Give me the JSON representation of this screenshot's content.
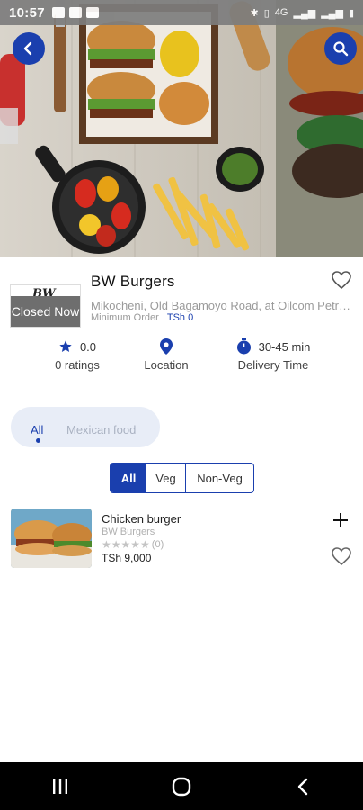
{
  "status_bar": {
    "time": "10:57",
    "network": "4G"
  },
  "hero": {
    "back_icon": "arrow-left-icon",
    "search_icon": "search-icon"
  },
  "restaurant": {
    "logo_text": "BW",
    "status": "Closed Now",
    "name": "BW Burgers",
    "address": "Mikocheni, Old Bagamoyo Road, at Oilcom Petrol Station",
    "min_order_label": "Minimum Order",
    "min_order_value": "TSh 0",
    "favorite_icon": "heart-outline-icon"
  },
  "stats": {
    "rating_value": "0.0",
    "rating_label": "0 ratings",
    "location_label": "Location",
    "delivery_value": "30-45 min",
    "delivery_label": "Delivery Time"
  },
  "categories": {
    "items": [
      "All",
      "Mexican food"
    ],
    "selected": "All"
  },
  "filter": {
    "options": [
      "All",
      "Veg",
      "Non-Veg"
    ],
    "selected": "All"
  },
  "menu_items": [
    {
      "name": "Chicken burger",
      "restaurant": "BW Burgers",
      "stars": 0,
      "rating_count": "(0)",
      "price": "TSh 9,000"
    }
  ],
  "colors": {
    "accent": "#1a3fae",
    "closed_overlay": "#6e6e6e",
    "pill_bg": "#e8edf7"
  },
  "nav": {
    "recents_icon": "recents-icon",
    "home_icon": "home-icon",
    "back_icon": "back-icon"
  }
}
